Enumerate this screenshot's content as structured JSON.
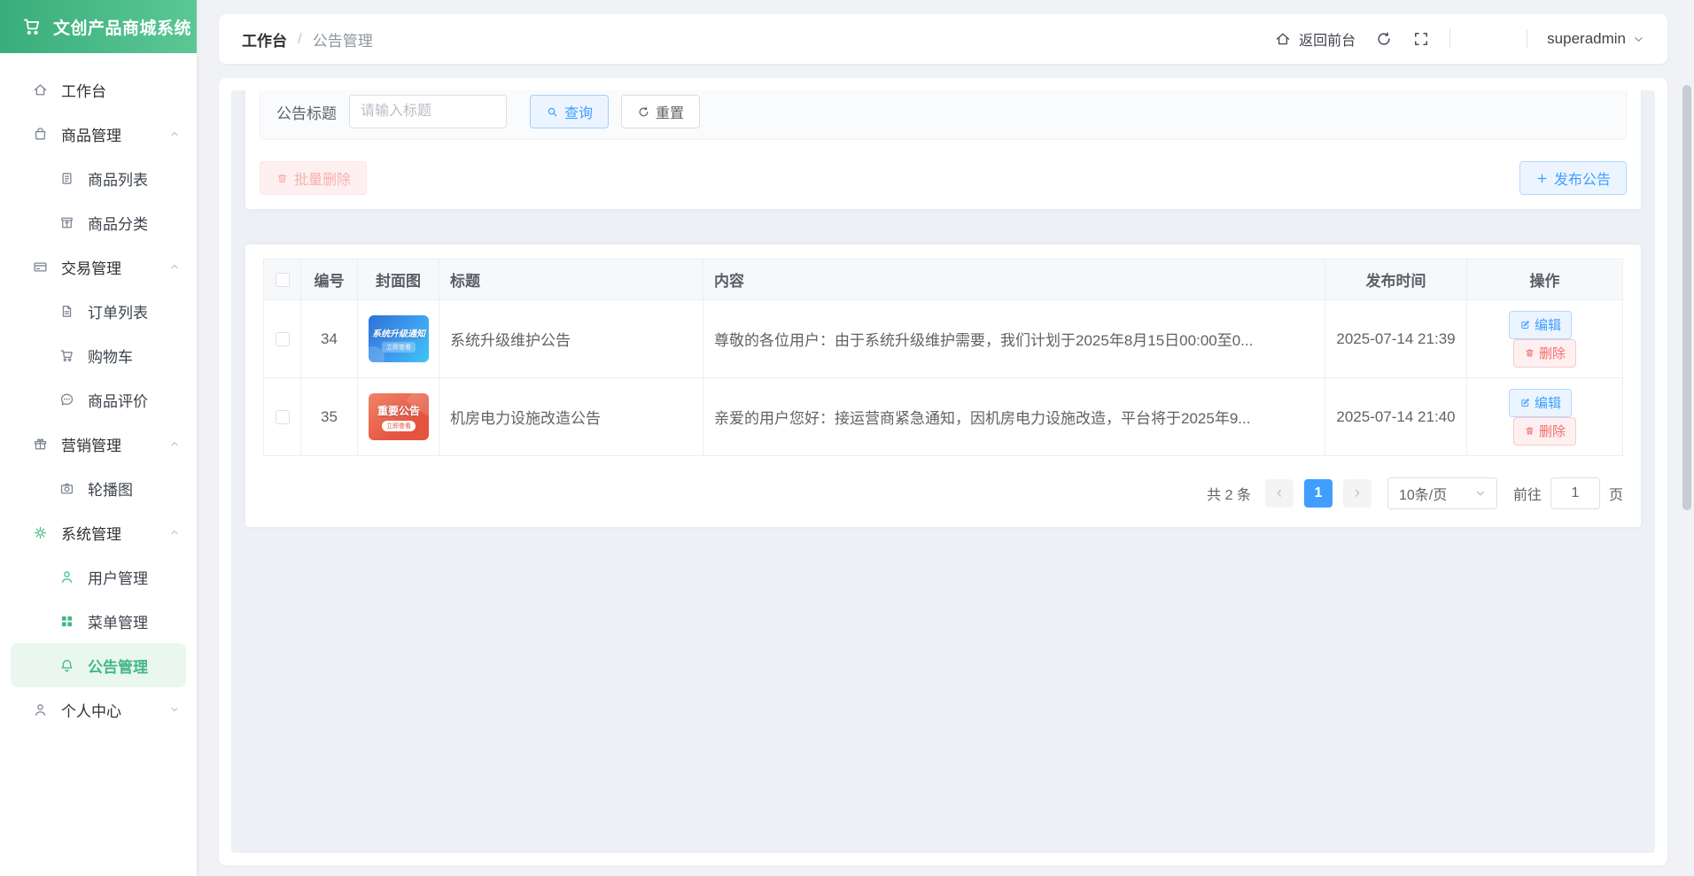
{
  "app": {
    "title": "文创产品商城系统"
  },
  "colors": {
    "brand_green": "#42b983",
    "accent_blue": "#409eff",
    "danger_red": "#f56c6c",
    "page_bg": "#f0f2f5"
  },
  "sidebar": {
    "items": [
      {
        "label": "工作台",
        "icon": "home-icon",
        "level": 1
      },
      {
        "label": "商品管理",
        "icon": "shopping-bag-icon",
        "level": 1,
        "state": "expanded"
      },
      {
        "label": "商品列表",
        "icon": "list-icon",
        "level": 2
      },
      {
        "label": "商品分类",
        "icon": "category-box-icon",
        "level": 2
      },
      {
        "label": "交易管理",
        "icon": "bank-card-icon",
        "level": 1,
        "state": "expanded"
      },
      {
        "label": "订单列表",
        "icon": "document-icon",
        "level": 2
      },
      {
        "label": "购物车",
        "icon": "cart-icon",
        "level": 2
      },
      {
        "label": "商品评价",
        "icon": "comment-icon",
        "level": 2
      },
      {
        "label": "营销管理",
        "icon": "gift-icon",
        "level": 1,
        "state": "expanded"
      },
      {
        "label": "轮播图",
        "icon": "camera-icon",
        "level": 2
      },
      {
        "label": "系统管理",
        "icon": "gear-icon",
        "level": 1,
        "state": "expanded"
      },
      {
        "label": "用户管理",
        "icon": "user-icon",
        "level": 2
      },
      {
        "label": "菜单管理",
        "icon": "grid-icon",
        "level": 2
      },
      {
        "label": "公告管理",
        "icon": "bell-icon",
        "level": 2,
        "state": "active"
      },
      {
        "label": "个人中心",
        "icon": "profile-icon",
        "level": 1,
        "state": "collapsed"
      }
    ]
  },
  "topbar": {
    "breadcrumb_root": "工作台",
    "breadcrumb_separator": "/",
    "breadcrumb_current": "公告管理",
    "back_label": "返回前台",
    "username": "superadmin"
  },
  "filters": {
    "title_label": "公告标题",
    "title_placeholder": "请输入标题",
    "search_label": "查询",
    "reset_label": "重置"
  },
  "toolbar": {
    "batch_delete_label": "批量删除",
    "publish_label": "发布公告"
  },
  "table": {
    "headers": {
      "id": "编号",
      "cover": "封面图",
      "title": "标题",
      "content": "内容",
      "time": "发布时间",
      "actions": "操作"
    },
    "edit_label": "编辑",
    "delete_label": "删除",
    "rows": [
      {
        "id": "34",
        "cover_title": "系统升级通知",
        "cover_badge": "立即查看",
        "title": "系统升级维护公告",
        "content": "尊敬的各位用户：由于系统升级维护需要，我们计划于2025年8月15日00:00至0...",
        "time": "2025-07-14 21:39"
      },
      {
        "id": "35",
        "cover_title": "重要公告",
        "cover_badge": "立即查看",
        "title": "机房电力设施改造公告",
        "content": "亲爱的用户您好：接运营商紧急通知，因机房电力设施改造，平台将于2025年9...",
        "time": "2025-07-14 21:40"
      }
    ]
  },
  "pagination": {
    "total": "共 2 条",
    "current_page": "1",
    "page_size": "10条/页",
    "goto_label": "前往",
    "goto_value": "1",
    "goto_unit": "页"
  }
}
